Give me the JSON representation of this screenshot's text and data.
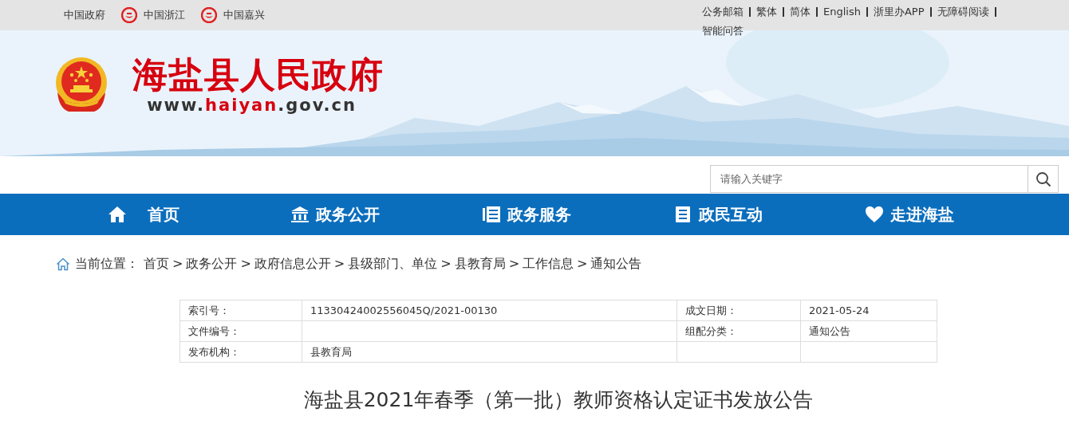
{
  "top_bar": {
    "left_links": [
      {
        "label": "中国政府",
        "kind": "plain"
      },
      {
        "label": "中国浙江",
        "kind": "emblem"
      },
      {
        "label": "中国嘉兴",
        "kind": "emblem"
      }
    ],
    "right_links": [
      "公务邮箱",
      "繁体",
      "简体",
      "English",
      "浙里办APP",
      "无障碍阅读",
      "智能问答"
    ]
  },
  "banner": {
    "title": "海盐县人民政府",
    "url_prefix": "www.",
    "url_domain": "haiyan",
    "url_suffix": ".gov.cn"
  },
  "search": {
    "placeholder": "请输入关键字"
  },
  "nav": [
    {
      "label": "首页"
    },
    {
      "label": "政务公开"
    },
    {
      "label": "政务服务"
    },
    {
      "label": "政民互动"
    },
    {
      "label": "走进海盐"
    }
  ],
  "breadcrumb": {
    "label": "当前位置：",
    "separator": ">",
    "items": [
      "首页",
      "政务公开",
      "政府信息公开",
      "县级部门、单位",
      "县教育局",
      "工作信息",
      "通知公告"
    ]
  },
  "info_table": {
    "rows": [
      [
        "索引号：",
        "11330424002556045Q/2021-00130",
        "成文日期：",
        "2021-05-24"
      ],
      [
        "文件编号：",
        "",
        "组配分类：",
        "通知公告"
      ],
      [
        "发布机构：",
        "县教育局",
        "",
        ""
      ]
    ]
  },
  "article_title": "海盐县2021年春季（第一批）教师资格认定证书发放公告"
}
